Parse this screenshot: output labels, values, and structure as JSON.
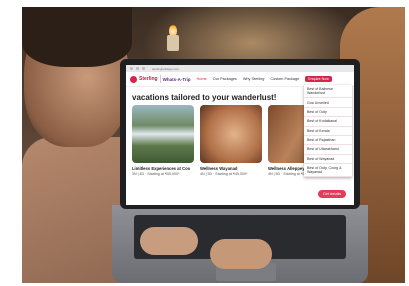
{
  "browser": {
    "url": "sterlingholidays.com"
  },
  "site": {
    "logo_primary": "Sterling",
    "logo_secondary": "Whats-A-Trip",
    "nav": [
      {
        "label": "Home",
        "active": true
      },
      {
        "label": "Our Packages"
      },
      {
        "label": "Why Sterling"
      },
      {
        "label": "Custom Package"
      }
    ],
    "nav_button": "Enquire Now",
    "headline": "vacations tailored to your wanderlust!",
    "cards": [
      {
        "title": "Limitless Experiences at Coo",
        "sub": "3N | 4D · Starting at ₹50,000*"
      },
      {
        "title": "Wellness Wayanad",
        "sub": "4N | 5D · Starting at ₹45,000*"
      },
      {
        "title": "Wellness Alleppey",
        "sub": "4N | 5D · Starting at ₹52,000*"
      }
    ],
    "dropdown": [
      "Best of Balinese Wanderlust",
      "Goa Unveiled",
      "Best of Ooty",
      "Best of Kodaikanal",
      "Best of Kerala",
      "Best of Rajasthan",
      "Best of Uttarakhand",
      "Best of Wayanad",
      "Best of Ooty, Coorg & Wayanad"
    ],
    "enquire_label": "Get details"
  },
  "colors": {
    "brand": "#d3264a",
    "brand_dark": "#5b2a7a"
  }
}
